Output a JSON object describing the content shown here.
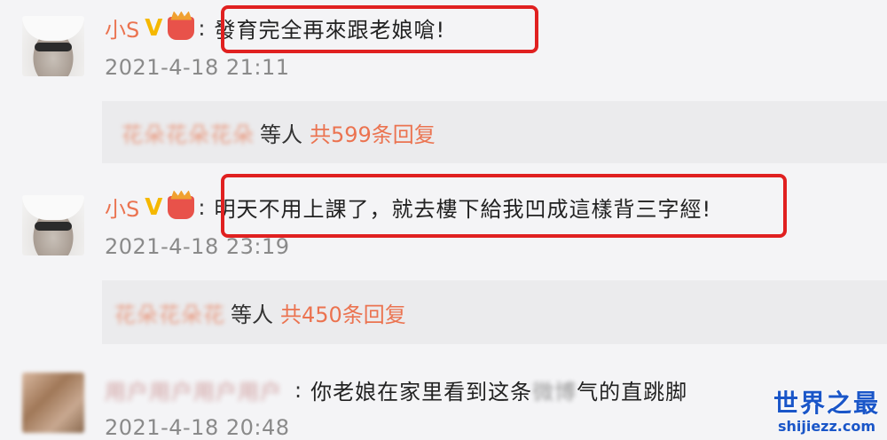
{
  "comments": [
    {
      "username": "小S",
      "verified_badge": "V",
      "colon": ":",
      "text": "發育完全再來跟老娘嗆!",
      "timestamp": "2021-4-18 21:11",
      "reply_blurred_names": "花朵花朵花朵",
      "reply_suffix": "等人",
      "reply_count": "共599条回复"
    },
    {
      "username": "小S",
      "verified_badge": "V",
      "colon": ":",
      "text": "明天不用上課了，就去樓下給我凹成這樣背三字經!",
      "timestamp": "2021-4-18 23:19",
      "reply_blurred_names": "花朵花朵花",
      "reply_suffix": "等人",
      "reply_count": "共450条回复"
    },
    {
      "username_blurred": "用户用户用户用户",
      "colon": ":",
      "text_before": "你老娘在家里看到这条",
      "text_blurred": "微博",
      "text_after": "气的直跳脚",
      "timestamp": "2021-4-18 20:48"
    }
  ],
  "watermark": {
    "title": "世界之最",
    "url": "shijiezz.com"
  },
  "colors": {
    "username": "#eb7350",
    "badge": "#f5b800",
    "highlight": "#e02020",
    "timestamp": "#8a8a8a",
    "reply_bg": "#ebebed",
    "watermark": "#1a56c8"
  }
}
